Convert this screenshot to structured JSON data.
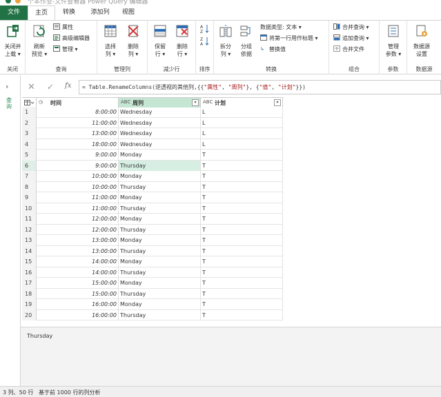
{
  "window": {
    "title": "个本作业-文件查看器 Power Query 编辑器"
  },
  "tabs": [
    {
      "label": "文件"
    },
    {
      "label": "主页"
    },
    {
      "label": "转换"
    },
    {
      "label": "添加列"
    },
    {
      "label": "视图"
    }
  ],
  "ribbon": {
    "close": {
      "btn1": "关闭并",
      "btn2": "上载 ▾",
      "group": "关闭"
    },
    "query": {
      "refresh1": "刷新",
      "refresh2": "预览 ▾",
      "properties": "属性",
      "advanced": "高级编辑器",
      "manage": "管理 ▾",
      "group": "查询"
    },
    "manage_cols": {
      "select1": "选择",
      "select2": "列 ▾",
      "remove1": "删除",
      "remove2": "列 ▾",
      "group": "管理列"
    },
    "reduce_rows": {
      "keep1": "保留",
      "keep2": "行 ▾",
      "remove1": "删除",
      "remove2": "行 ▾",
      "group": "减少行"
    },
    "sort": {
      "group": "排序"
    },
    "transform": {
      "split1": "拆分",
      "split2": "列 ▾",
      "group1": "分组",
      "group2": "依据",
      "datatype": "数据类型: 文本 ▾",
      "first_row": "将第一行用作标题 ▾",
      "replace": "替换值",
      "group": "转换"
    },
    "combine": {
      "merge": "合并查询 ▾",
      "append": "追加查询 ▾",
      "combine_files": "合并文件",
      "group": "组合"
    },
    "params": {
      "manage1": "管理",
      "manage2": "参数 ▾",
      "group": "参数"
    },
    "datasource": {
      "btn1": "数据源",
      "btn2": "设置",
      "group": "数据源"
    }
  },
  "leftnav": {
    "label": "查询"
  },
  "formula": {
    "prefix": "= Table.RenameColumns(逆透视的其他列,{{",
    "s1": "\"属性\"",
    "sep1": ", ",
    "s2": "\"周列\"",
    "sep2": "}, {",
    "s3": "\"值\"",
    "sep3": ", ",
    "s4": "\"计划\"",
    "suffix": "}})"
  },
  "columns": [
    {
      "type": "◷",
      "name": "时间"
    },
    {
      "type": "ABC",
      "name": "周列"
    },
    {
      "type": "ABC",
      "name": "计划"
    }
  ],
  "rows": [
    [
      "1",
      "8:00:00",
      "Wednesday",
      "L"
    ],
    [
      "2",
      "11:00:00",
      "Wednesday",
      "L"
    ],
    [
      "3",
      "13:00:00",
      "Wednesday",
      "L"
    ],
    [
      "4",
      "18:00:00",
      "Wednesday",
      "L"
    ],
    [
      "5",
      "9:00:00",
      "Monday",
      "T"
    ],
    [
      "6",
      "9:00:00",
      "Thursday",
      "T"
    ],
    [
      "7",
      "10:00:00",
      "Monday",
      "T"
    ],
    [
      "8",
      "10:00:00",
      "Thursday",
      "T"
    ],
    [
      "9",
      "11:00:00",
      "Monday",
      "T"
    ],
    [
      "10",
      "11:00:00",
      "Thursday",
      "T"
    ],
    [
      "11",
      "12:00:00",
      "Monday",
      "T"
    ],
    [
      "12",
      "12:00:00",
      "Thursday",
      "T"
    ],
    [
      "13",
      "13:00:00",
      "Monday",
      "T"
    ],
    [
      "14",
      "13:00:00",
      "Thursday",
      "T"
    ],
    [
      "15",
      "14:00:00",
      "Monday",
      "T"
    ],
    [
      "16",
      "14:00:00",
      "Thursday",
      "T"
    ],
    [
      "17",
      "15:00:00",
      "Monday",
      "T"
    ],
    [
      "18",
      "15:00:00",
      "Thursday",
      "T"
    ],
    [
      "19",
      "16:00:00",
      "Monday",
      "T"
    ],
    [
      "20",
      "16:00:00",
      "Thursday",
      "T"
    ]
  ],
  "preview": {
    "value": "Thursday"
  },
  "status": {
    "left": "3 列、50 行",
    "right": "基于前 1000 行的列分析"
  },
  "colors": {
    "accent": "#217346",
    "header_underline": "#2a9d8f",
    "selected_cell": "#d6efe2"
  }
}
